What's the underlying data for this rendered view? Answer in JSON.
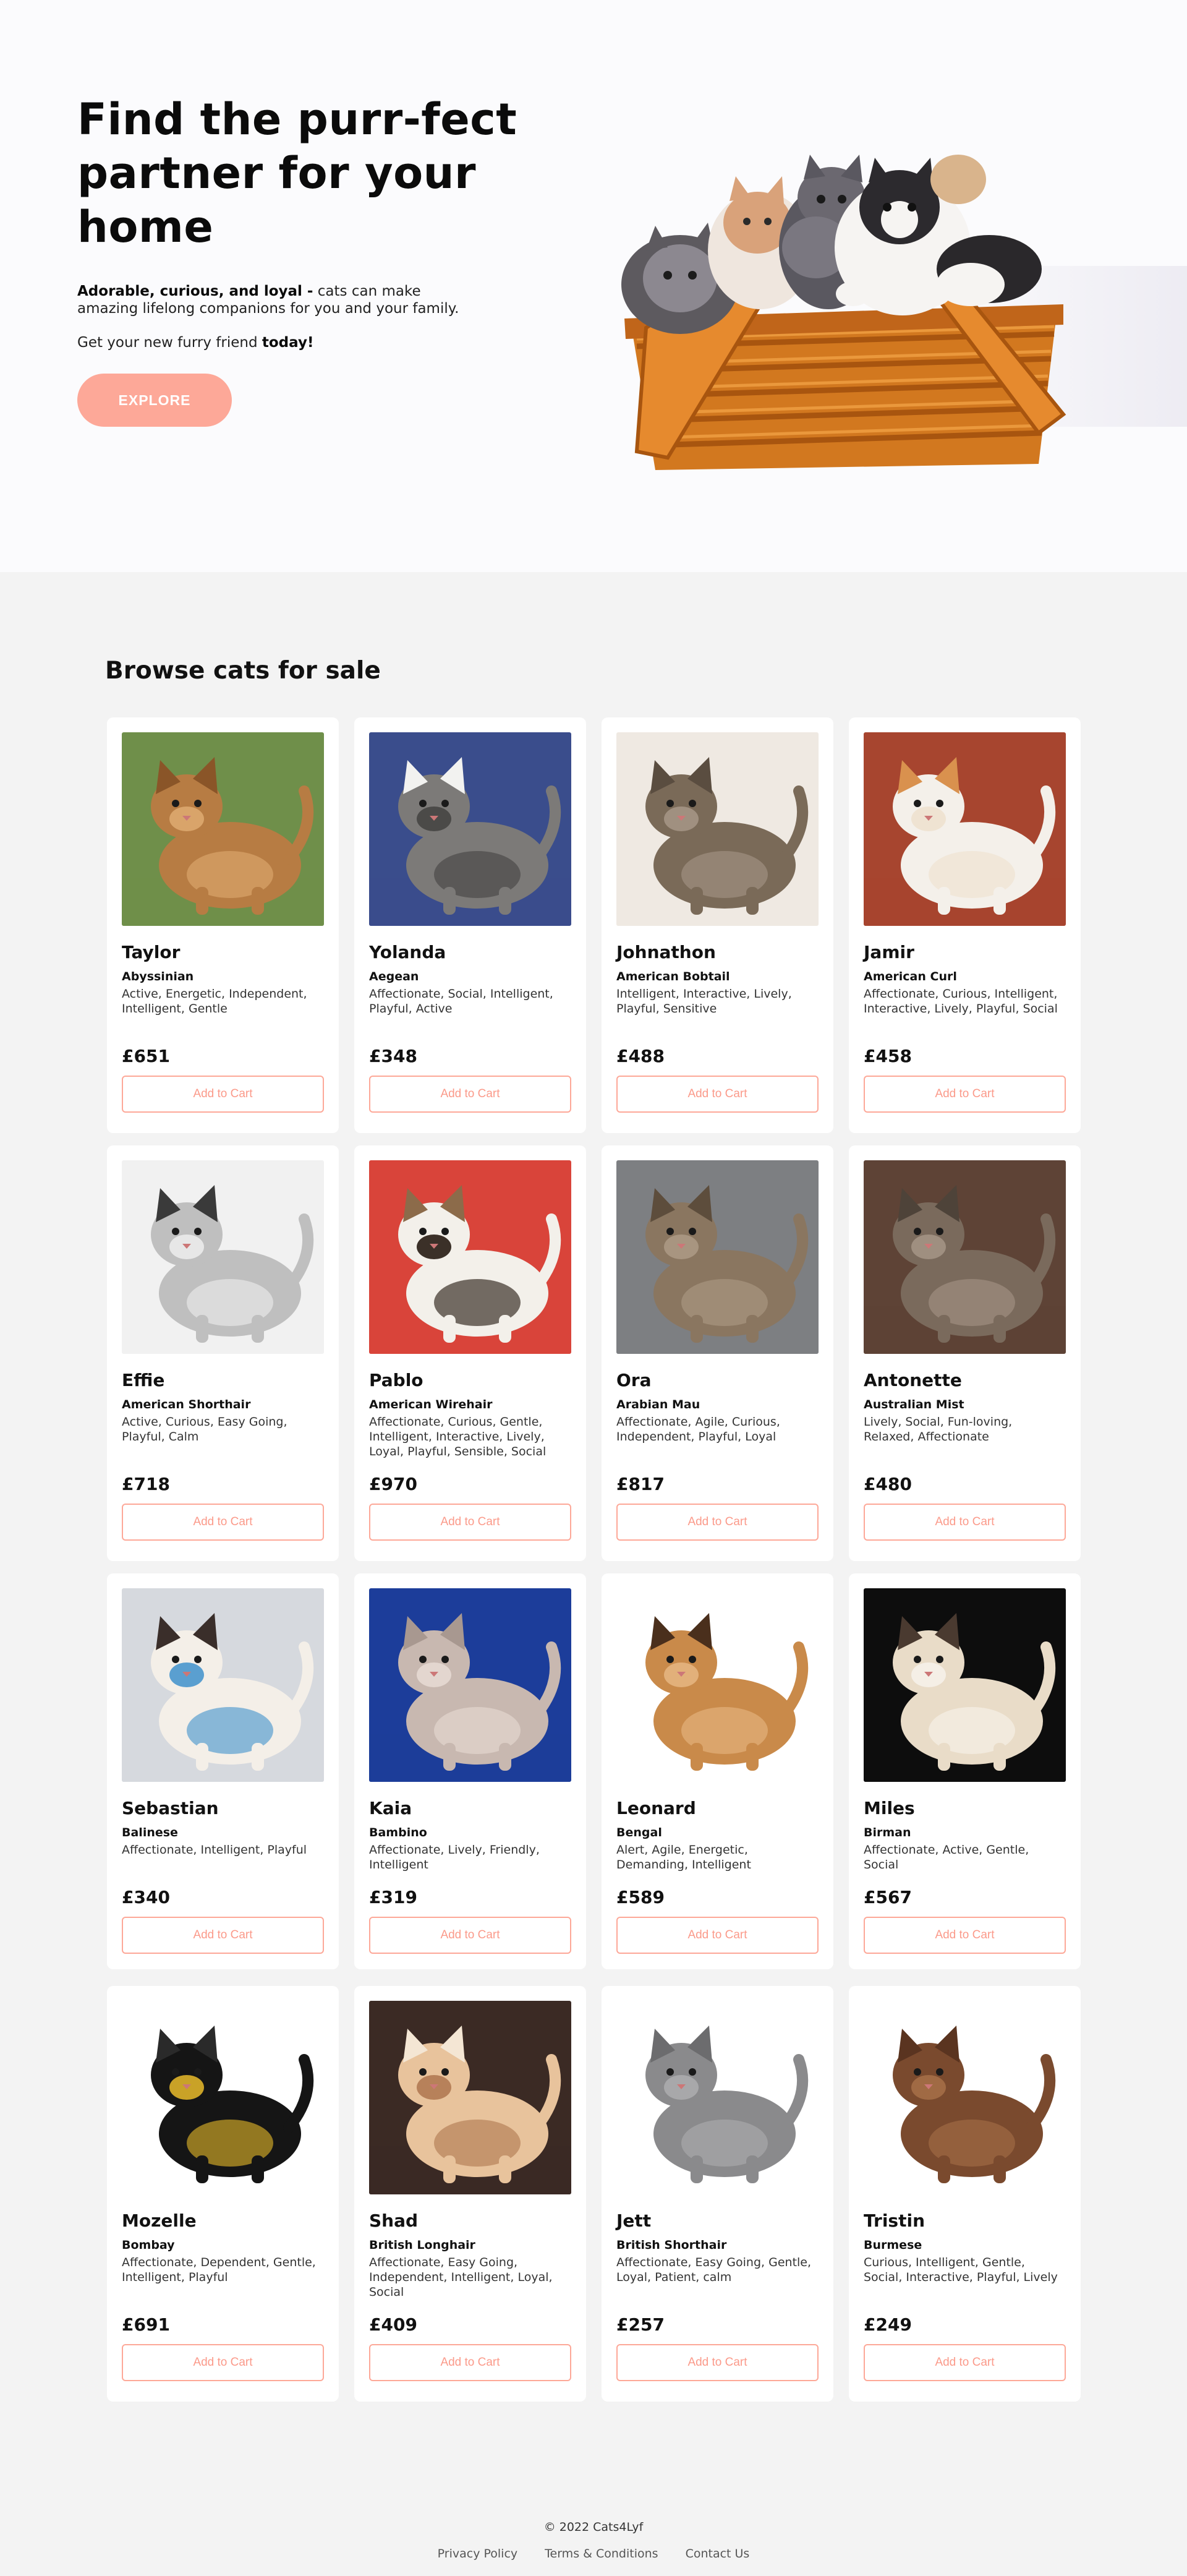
{
  "hero": {
    "title": "Find the purr-fect partner for your home",
    "tagline_bold": "Adorable, curious, and loyal -",
    "tagline_rest": " cats can make amazing lifelong companions for you and your family.",
    "cta_text_start": "Get your new furry friend ",
    "cta_text_bold": "today!",
    "explore_label": "EXPLORE",
    "image": "kittens-in-basket-photo"
  },
  "browse": {
    "title": "Browse cats for sale",
    "add_to_cart_label": "Add to Cart",
    "cats": [
      {
        "name": "Taylor",
        "breed": "Abyssinian",
        "traits": "Active, Energetic, Independent, Intelligent, Gentle",
        "price": "£651",
        "photo": "abyssinian-cat-photo",
        "colors": [
          "#b77c43",
          "#8a5528",
          "#d9a46a"
        ],
        "bg": "#6f8f4a"
      },
      {
        "name": "Yolanda",
        "breed": "Aegean",
        "traits": "Affectionate, Social, Intelligent, Playful, Active",
        "price": "£348",
        "photo": "aegean-cat-photo",
        "colors": [
          "#7c7a78",
          "#f2f2f0",
          "#4b4a48"
        ],
        "bg": "#3a4d8c"
      },
      {
        "name": "Johnathon",
        "breed": "American Bobtail",
        "traits": "Intelligent, Interactive, Lively, Playful, Sensitive",
        "price": "£488",
        "photo": "american-bobtail-cat-photo",
        "colors": [
          "#7a6a58",
          "#5a4d40",
          "#a09080"
        ],
        "bg": "#efe9e2"
      },
      {
        "name": "Jamir",
        "breed": "American Curl",
        "traits": "Affectionate, Curious, Intelligent, Interactive, Lively, Playful, Social",
        "price": "£458",
        "photo": "american-curl-cat-photo",
        "colors": [
          "#f4f0ea",
          "#d9914e",
          "#efe3d2"
        ],
        "bg": "#a7452f"
      },
      {
        "name": "Effie",
        "breed": "American Shorthair",
        "traits": "Active, Curious, Easy Going, Playful, Calm",
        "price": "£718",
        "photo": "american-shorthair-cat-photo",
        "colors": [
          "#bfbfbf",
          "#3a3a3a",
          "#e7e7e7"
        ],
        "bg": "#f1f1f1"
      },
      {
        "name": "Pablo",
        "breed": "American Wirehair",
        "traits": "Affectionate, Curious, Gentle, Intelligent, Interactive, Lively, Loyal, Playful, Sensible, Social",
        "price": "£970",
        "photo": "american-wirehair-cat-photo",
        "colors": [
          "#f3f0ea",
          "#8c6b4a",
          "#3b3028"
        ],
        "bg": "#d9443a"
      },
      {
        "name": "Ora",
        "breed": "Arabian Mau",
        "traits": "Affectionate, Agile, Curious, Independent, Playful, Loyal",
        "price": "£817",
        "photo": "arabian-mau-cat-photo",
        "colors": [
          "#8a7660",
          "#5d4d3c",
          "#a89580"
        ],
        "bg": "#7d7f82"
      },
      {
        "name": "Antonette",
        "breed": "Australian Mist",
        "traits": "Lively, Social, Fun-loving, Relaxed, Affectionate",
        "price": "£480",
        "photo": "australian-mist-cat-photo",
        "colors": [
          "#7a6a5c",
          "#4e4339",
          "#9f8f80"
        ],
        "bg": "#5e4336"
      },
      {
        "name": "Sebastian",
        "breed": "Balinese",
        "traits": "Affectionate, Intelligent, Playful",
        "price": "£340",
        "photo": "balinese-cat-photo",
        "colors": [
          "#f4efe8",
          "#3a2e2a",
          "#5a9fd0"
        ],
        "bg": "#d6d9de"
      },
      {
        "name": "Kaia",
        "breed": "Bambino",
        "traits": "Affectionate, Lively, Friendly, Intelligent",
        "price": "£319",
        "photo": "bambino-cat-photo",
        "colors": [
          "#c8b8b0",
          "#a89890",
          "#e3d6cf"
        ],
        "bg": "#1c3d9a"
      },
      {
        "name": "Leonard",
        "breed": "Bengal",
        "traits": "Alert, Agile, Energetic, Demanding, Intelligent",
        "price": "£589",
        "photo": "bengal-cat-photo",
        "colors": [
          "#c98a4a",
          "#4a2f1c",
          "#e2b07a"
        ],
        "bg": "#ffffff"
      },
      {
        "name": "Miles",
        "breed": "Birman",
        "traits": "Affectionate, Active, Gentle, Social",
        "price": "£567",
        "photo": "birman-cat-photo",
        "colors": [
          "#e9dcc8",
          "#4a3a30",
          "#f5efe6"
        ],
        "bg": "#0d0d0d"
      },
      {
        "name": "Mozelle",
        "breed": "Bombay",
        "traits": "Affectionate, Dependent, Gentle, Intelligent, Playful",
        "price": "£691",
        "photo": "bombay-cat-photo",
        "colors": [
          "#151515",
          "#2a2a2a",
          "#c9a227"
        ],
        "bg": "#ffffff"
      },
      {
        "name": "Shad",
        "breed": "British Longhair",
        "traits": "Affectionate, Easy Going, Independent, Intelligent, Loyal, Social",
        "price": "£409",
        "photo": "british-longhair-cat-photo",
        "colors": [
          "#e8c39c",
          "#f4e6d4",
          "#b7815a"
        ],
        "bg": "#3b2a24"
      },
      {
        "name": "Jett",
        "breed": "British Shorthair",
        "traits": "Affectionate, Easy Going, Gentle, Loyal, Patient, calm",
        "price": "£257",
        "photo": "british-shorthair-cat-photo",
        "colors": [
          "#8a8a8c",
          "#6c6c6e",
          "#a8a8aa"
        ],
        "bg": "#ffffff"
      },
      {
        "name": "Tristin",
        "breed": "Burmese",
        "traits": "Curious, Intelligent, Gentle, Social, Interactive, Playful, Lively",
        "price": "£249",
        "photo": "burmese-cat-photo",
        "colors": [
          "#7a4a2e",
          "#5a3420",
          "#a06a44"
        ],
        "bg": "#ffffff"
      }
    ]
  },
  "footer": {
    "copyright": "© 2022 Cats4Lyf",
    "links": [
      "Privacy Policy",
      "Terms & Conditions",
      "Contact Us"
    ]
  }
}
